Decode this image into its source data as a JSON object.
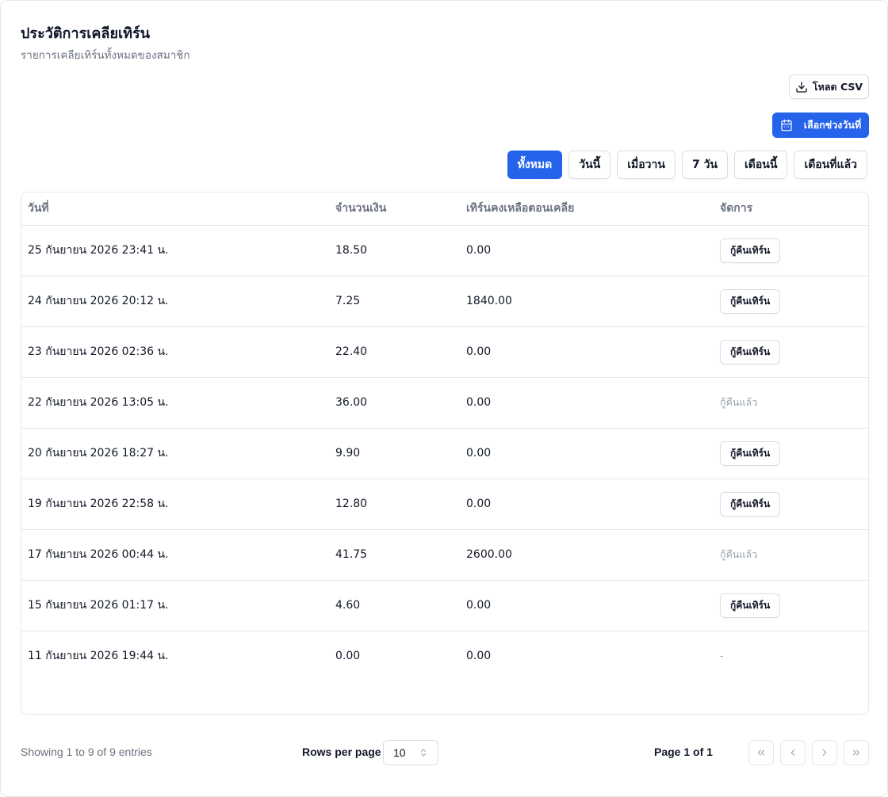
{
  "header": {
    "title": "ประวัติการเคลียเทิร์น",
    "subtitle": "รายการเคลียเทิร์นทั้งหมดของสมาชิก"
  },
  "toolbar": {
    "csv_label": "โหลด CSV",
    "date_range_label": "เลือกช่วงวันที่"
  },
  "filters": [
    "ทั้งหมด",
    "วันนี้",
    "เมื่อวาน",
    "7 วัน",
    "เดือนนี้",
    "เดือนที่แล้ว"
  ],
  "active_filter": "ทั้งหมด",
  "table": {
    "columns": [
      "วันที่",
      "จำนวนเงิน",
      "เทิร์นคงเหลือตอนเคลีย",
      "จัดการ"
    ],
    "rows": [
      {
        "date": "25 กันยายน 2026 23:41 น.",
        "amount": "18.50",
        "remaining": "0.00",
        "action": "กู้คืนเทิร์น",
        "action_type": "button"
      },
      {
        "date": "24 กันยายน 2026 20:12 น.",
        "amount": "7.25",
        "remaining": "1840.00",
        "action": "กู้คืนเทิร์น",
        "action_type": "button"
      },
      {
        "date": "23 กันยายน 2026 02:36 น.",
        "amount": "22.40",
        "remaining": "0.00",
        "action": "กู้คืนเทิร์น",
        "action_type": "button"
      },
      {
        "date": "22 กันยายน 2026 13:05 น.",
        "amount": "36.00",
        "remaining": "0.00",
        "action": "กู้คืนแล้ว",
        "action_type": "text"
      },
      {
        "date": "20 กันยายน 2026 18:27 น.",
        "amount": "9.90",
        "remaining": "0.00",
        "action": "กู้คืนเทิร์น",
        "action_type": "button"
      },
      {
        "date": "19 กันยายน 2026 22:58 น.",
        "amount": "12.80",
        "remaining": "0.00",
        "action": "กู้คืนเทิร์น",
        "action_type": "button"
      },
      {
        "date": "17 กันยายน 2026 00:44 น.",
        "amount": "41.75",
        "remaining": "2600.00",
        "action": "กู้คืนแล้ว",
        "action_type": "text"
      },
      {
        "date": "15 กันยายน 2026 01:17 น.",
        "amount": "4.60",
        "remaining": "0.00",
        "action": "กู้คืนเทิร์น",
        "action_type": "button"
      },
      {
        "date": "11 กันยายน 2026 19:44 น.",
        "amount": "0.00",
        "remaining": "0.00",
        "action": "-",
        "action_type": "text"
      }
    ]
  },
  "footer": {
    "showing": "Showing 1 to 9 of 9 entries",
    "rows_per_page_label": "Rows per page",
    "rows_per_page_value": "10",
    "page_label": "Page 1 of 1"
  },
  "icons": {
    "csv": "download-icon",
    "date": "calendar-icon",
    "select": "chevron-up-down-icon",
    "first": "chevrons-left-icon",
    "prev": "chevron-left-icon",
    "next": "chevron-right-icon",
    "last": "chevrons-right-icon"
  },
  "colors": {
    "primary": "#2563eb",
    "border": "#e5e7eb",
    "muted_text": "#6b7280"
  }
}
